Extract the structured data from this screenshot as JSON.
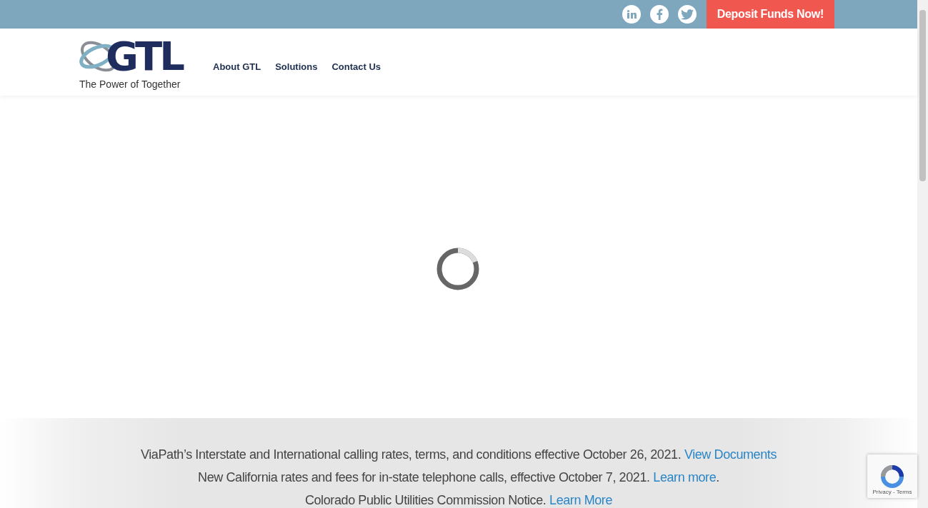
{
  "top_bar": {
    "social": [
      {
        "kind": "linkedin"
      },
      {
        "kind": "facebook"
      },
      {
        "kind": "twitter"
      }
    ],
    "cta": "Deposit Funds Now!"
  },
  "header": {
    "tagline": "The Power of Together",
    "logo_text": "GTL",
    "nav": [
      "About GTL",
      "Solutions",
      "Contact Us"
    ]
  },
  "notices": [
    {
      "text": "ViaPath’s Interstate and International calling rates, terms, and conditions effective October 26, 2021.",
      "link": "View Documents"
    },
    {
      "text": "New California rates and fees for in-state telephone calls, effective October 7, 2021.",
      "link": "Learn more",
      "after": "."
    },
    {
      "text": "Colorado Public Utilities Commission Notice.",
      "link": "Learn More"
    }
  ],
  "recaptcha": {
    "links": "Privacy - Terms"
  }
}
